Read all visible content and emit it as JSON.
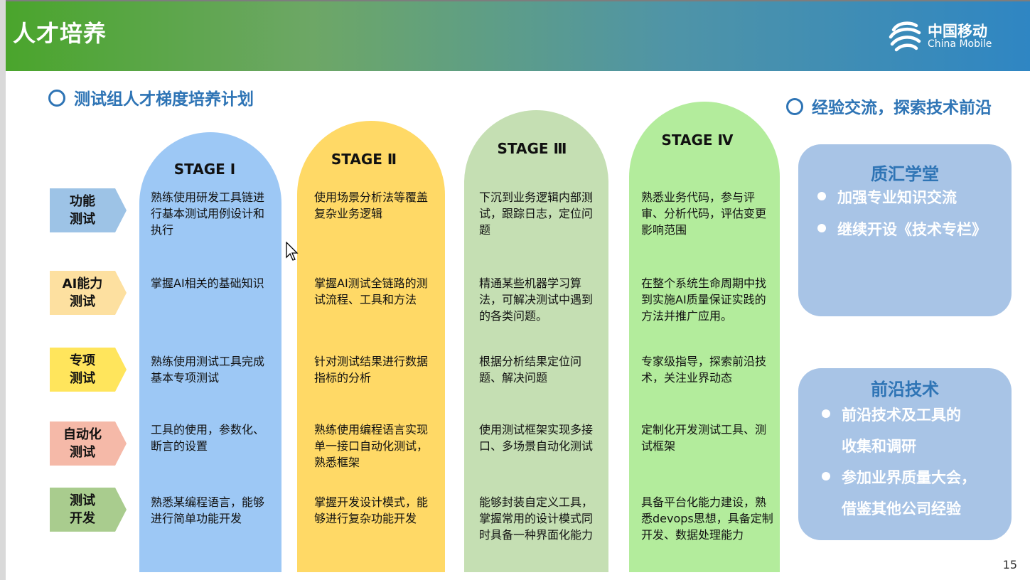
{
  "title": "人才培养",
  "logo": {
    "cn": "中国移动",
    "en": "China Mobile"
  },
  "left_section_title": "测试组人才梯度培养计划",
  "right_section_title": "经验交流，探索技术前沿",
  "rows": [
    {
      "label": "功能\n测试",
      "color": "#9dc3e6"
    },
    {
      "label": "AI能力\n测试",
      "color": "#fde0a0"
    },
    {
      "label": "专项\n测试",
      "color": "#ffe55c"
    },
    {
      "label": "自动化\n测试",
      "color": "#f5b9a8"
    },
    {
      "label": "测试\n开发",
      "color": "#a9cc8e"
    }
  ],
  "stages": [
    {
      "title": "STAGE Ⅰ",
      "color": "#9dc8f5",
      "cells": [
        "熟练使用研发工具链进行基本测试用例设计和执行",
        "掌握AI相关的基础知识",
        "熟练使用测试工具完成基本专项测试",
        "工具的使用，参数化、断言的设置",
        "熟悉某编程语言，能够进行简单功能开发"
      ]
    },
    {
      "title": "STAGE Ⅱ",
      "color": "#ffd966",
      "cells": [
        "使用场景分析法等覆盖复杂业务逻辑",
        "掌握AI测试全链路的测试流程、工具和方法",
        "针对测试结果进行数据指标的分析",
        "熟练使用编程语言实现单一接口自动化测试，熟悉框架",
        "掌握开发设计模式，能够进行复杂功能开发"
      ]
    },
    {
      "title": "STAGE Ⅲ",
      "color": "#c5dfb3",
      "cells": [
        "下沉到业务逻辑内部测试，跟踪日志，定位问题",
        "精通某些机器学习算法，可解决测试中遇到的各类问题。",
        "根据分析结果定位问题、解决问题",
        "使用测试框架实现多接口、多场景自动化测试",
        "能够封装自定义工具，掌握常用的设计模式同时具备一种界面化能力"
      ]
    },
    {
      "title": "STAGE Ⅳ",
      "color": "#b3ec9c",
      "cells": [
        "熟悉业务代码，参与评审、分析代码，评估变更影响范围",
        "在整个系统生命周期中找到实施AI质量保证实践的方法并推广应用。",
        "专家级指导，探索前沿技术，关注业界动态",
        "定制化开发测试工具、测试框架",
        "具备平台化能力建设，熟悉devops思想，具备定制开发、数据处理能力"
      ]
    }
  ],
  "side_boxes": [
    {
      "title": "质汇学堂",
      "bullets": [
        [
          "加强专业知识交流"
        ],
        [
          "继续开设《技术专栏》"
        ]
      ]
    },
    {
      "title": "前沿技术",
      "bullets": [
        [
          "前沿技术及工具的",
          "收集和调研"
        ],
        [
          "参加业界质量大会，",
          "借鉴其他公司经验"
        ]
      ]
    }
  ],
  "page_number": "15"
}
